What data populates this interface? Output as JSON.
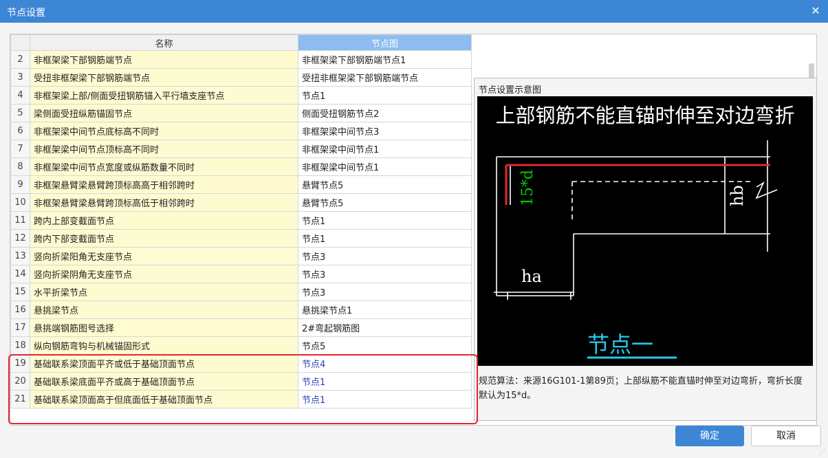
{
  "window": {
    "title": "节点设置",
    "close_icon": "close-icon"
  },
  "table": {
    "headers": {
      "index": "",
      "name": "名称",
      "image": "节点图"
    },
    "rows": [
      {
        "index": "2",
        "name": "非框架梁下部钢筋端节点",
        "value": "非框架梁下部钢筋端节点1",
        "highlight": false
      },
      {
        "index": "3",
        "name": "受扭非框架梁下部钢筋端节点",
        "value": "受扭非框架梁下部钢筋端节点",
        "highlight": false
      },
      {
        "index": "4",
        "name": "非框架梁上部/侧面受扭钢筋锚入平行墙支座节点",
        "value": "节点1",
        "highlight": false
      },
      {
        "index": "5",
        "name": "梁侧面受扭纵筋锚固节点",
        "value": "侧面受扭钢筋节点2",
        "highlight": false
      },
      {
        "index": "6",
        "name": "非框架梁中间节点底标高不同时",
        "value": "非框架梁中间节点3",
        "highlight": false
      },
      {
        "index": "7",
        "name": "非框架梁中间节点顶标高不同时",
        "value": "非框架梁中间节点1",
        "highlight": false
      },
      {
        "index": "8",
        "name": "非框架梁中间节点宽度或纵筋数量不同时",
        "value": "非框架梁中间节点1",
        "highlight": false
      },
      {
        "index": "9",
        "name": "非框架悬臂梁悬臂跨顶标高高于相邻跨时",
        "value": "悬臂节点5",
        "highlight": false
      },
      {
        "index": "10",
        "name": "非框架悬臂梁悬臂跨顶标高低于相邻跨时",
        "value": "悬臂节点5",
        "highlight": false
      },
      {
        "index": "11",
        "name": "跨内上部变截面节点",
        "value": "节点1",
        "highlight": false
      },
      {
        "index": "12",
        "name": "跨内下部变截面节点",
        "value": "节点1",
        "highlight": false
      },
      {
        "index": "13",
        "name": "竖向折梁阳角无支座节点",
        "value": "节点3",
        "highlight": false
      },
      {
        "index": "14",
        "name": "竖向折梁阴角无支座节点",
        "value": "节点3",
        "highlight": false
      },
      {
        "index": "15",
        "name": "水平折梁节点",
        "value": "节点3",
        "highlight": false
      },
      {
        "index": "16",
        "name": "悬挑梁节点",
        "value": "悬挑梁节点1",
        "highlight": false
      },
      {
        "index": "17",
        "name": "悬挑端钢筋图号选择",
        "value": "2#弯起钢筋图",
        "highlight": false
      },
      {
        "index": "18",
        "name": "纵向钢筋弯钩与机械锚固形式",
        "value": "节点5",
        "highlight": false
      },
      {
        "index": "19",
        "name": "基础联系梁顶面平齐或低于基础顶面节点",
        "value": "节点4",
        "highlight": true
      },
      {
        "index": "20",
        "name": "基础联系梁底面平齐或高于基础顶面节点",
        "value": "节点1",
        "highlight": true
      },
      {
        "index": "21",
        "name": "基础联系梁顶面高于但底面低于基础顶面节点",
        "value": "节点1",
        "highlight": true
      }
    ]
  },
  "diagram_panel": {
    "caption": "节点设置示意图",
    "heading": "上部钢筋不能直锚时伸至对边弯折",
    "label_vertical": "15*d",
    "label_hb": "hb",
    "label_ha": "ha",
    "node_title": "节点一",
    "description": "规范算法：来源16G101-1第89页；上部纵筋不能直锚时伸至对边弯折，弯折长度默认为15*d。"
  },
  "buttons": {
    "ok": "确定",
    "cancel": "取消"
  },
  "colors": {
    "title_bar": "#3d86d6",
    "highlight_border": "#e3262e",
    "rebar_red": "#e3262e",
    "label_green": "#00d000",
    "node_cyan": "#28c8e8"
  }
}
